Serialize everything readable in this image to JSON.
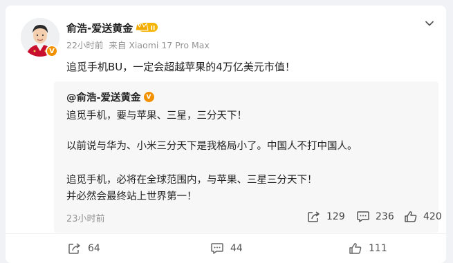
{
  "post": {
    "author": "俞浩-爱送黄金",
    "time": "22小时前",
    "source": "来自 Xiaomi 17 Pro Max",
    "text": "追觅手机BU，一定会超越苹果的4万亿美元市值！"
  },
  "quoted": {
    "author": "@俞浩-爱送黄金",
    "lines": [
      "追觅手机，要与苹果、三星，三分天下！",
      "以前说与华为、小米三分天下是我格局小了。中国人不打中国人。",
      "追觅手机，必将在全球范围内，与苹果、三星三分天下！",
      "并必然会最终站上世界第一！"
    ],
    "time": "23小时前",
    "reposts": "129",
    "comments": "236",
    "likes": "420"
  },
  "actions": {
    "reposts": "64",
    "comments": "44",
    "likes": "111"
  },
  "icons": {
    "verified": "verified-v-icon",
    "member": "member-crown-icon",
    "more": "chevron-down-icon",
    "repost": "repost-icon",
    "comment": "comment-icon",
    "like": "thumb-up-icon"
  },
  "colors": {
    "verified": "#f29100",
    "member": "#f5b400"
  }
}
